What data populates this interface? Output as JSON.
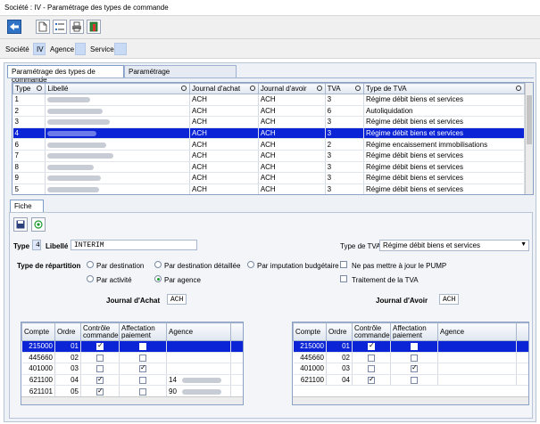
{
  "window": {
    "title": "Société : IV - Paramétrage des types de commande"
  },
  "toolbar": {
    "icons": [
      "back-arrow-icon",
      "new-document-icon",
      "list-icon",
      "print-icon",
      "exit-door-icon"
    ]
  },
  "context": {
    "societe_label": "Société",
    "societe_value": "IV",
    "agence_label": "Agence",
    "agence_value": "",
    "service_label": "Service",
    "service_value": ""
  },
  "tabs": [
    "Paramétrage des types de commande",
    "Paramétrage"
  ],
  "main_table": {
    "columns": [
      "Type",
      "Libellé",
      "Journal d'achat",
      "Journal d'avoir",
      "TVA",
      "Type de TVA"
    ],
    "rows": [
      {
        "type": "1",
        "achat": "ACH",
        "avoir": "ACH",
        "tva": "3",
        "type_tva": "Régime débit biens et services"
      },
      {
        "type": "2",
        "achat": "ACH",
        "avoir": "ACH",
        "tva": "6",
        "type_tva": "Autoliquidation"
      },
      {
        "type": "3",
        "achat": "ACH",
        "avoir": "ACH",
        "tva": "3",
        "type_tva": "Régime débit biens et services"
      },
      {
        "type": "4",
        "achat": "ACH",
        "avoir": "ACH",
        "tva": "3",
        "type_tva": "Régime débit biens et services"
      },
      {
        "type": "6",
        "achat": "ACH",
        "avoir": "ACH",
        "tva": "2",
        "type_tva": "Régime encaissement immobilisations"
      },
      {
        "type": "7",
        "achat": "ACH",
        "avoir": "ACH",
        "tva": "3",
        "type_tva": "Régime débit biens et services"
      },
      {
        "type": "8",
        "achat": "ACH",
        "avoir": "ACH",
        "tva": "3",
        "type_tva": "Régime débit biens et services"
      },
      {
        "type": "9",
        "achat": "ACH",
        "avoir": "ACH",
        "tva": "3",
        "type_tva": "Régime débit biens et services"
      },
      {
        "type": "5",
        "achat": "ACH",
        "avoir": "ACH",
        "tva": "3",
        "type_tva": "Régime débit biens et services"
      }
    ],
    "selected_index": 3
  },
  "fiche": {
    "tab_label": "Fiche",
    "type_label": "Type",
    "type_value": "4",
    "libelle_label": "Libellé",
    "libelle_value": "INTERIM",
    "type_tva_label": "Type de TVA",
    "type_tva_value": "Régime débit biens et services",
    "repartition_label": "Type de répartition",
    "radios": {
      "par_destination": "Par destination",
      "par_destination_detaillee": "Par destination détaillée",
      "par_imputation_budgetaire": "Par imputation budgétaire",
      "par_activite": "Par activité",
      "par_agence": "Par agence"
    },
    "selected_radio": "par_agence",
    "pump_label": "Ne pas mettre à jour le PUMP",
    "tva_treatment_label": "Traitement de la TVA",
    "journal_achat_label": "Journal d'Achat",
    "journal_achat_value": "ACH",
    "journal_avoir_label": "Journal d'Avoir",
    "journal_avoir_value": "ACH"
  },
  "achat_grid": {
    "columns": [
      "Compte",
      "Ordre",
      "Contrôle commande",
      "Affectation paiement",
      "Agence"
    ],
    "rows": [
      {
        "compte": "215000",
        "ordre": "01",
        "ctrl": true,
        "aff": false,
        "agence": ""
      },
      {
        "compte": "445660",
        "ordre": "02",
        "ctrl": false,
        "aff": false,
        "agence": ""
      },
      {
        "compte": "401000",
        "ordre": "03",
        "ctrl": false,
        "aff": true,
        "agence": ""
      },
      {
        "compte": "621100",
        "ordre": "04",
        "ctrl": true,
        "aff": false,
        "agence": "14"
      },
      {
        "compte": "621101",
        "ordre": "05",
        "ctrl": true,
        "aff": false,
        "agence": "90"
      }
    ],
    "selected_index": 0
  },
  "avoir_grid": {
    "columns": [
      "Compte",
      "Ordre",
      "Contrôle commande",
      "Affectation paiement",
      "Agence"
    ],
    "rows": [
      {
        "compte": "215000",
        "ordre": "01",
        "ctrl": true,
        "aff": false,
        "agence": ""
      },
      {
        "compte": "445660",
        "ordre": "02",
        "ctrl": false,
        "aff": false,
        "agence": ""
      },
      {
        "compte": "401000",
        "ordre": "03",
        "ctrl": false,
        "aff": true,
        "agence": ""
      },
      {
        "compte": "621100",
        "ordre": "04",
        "ctrl": true,
        "aff": false,
        "agence": ""
      }
    ],
    "selected_index": 0
  },
  "colors": {
    "selection": "#0a24d6",
    "context_box": "#c9daf4",
    "accent": "#2f73c7"
  }
}
